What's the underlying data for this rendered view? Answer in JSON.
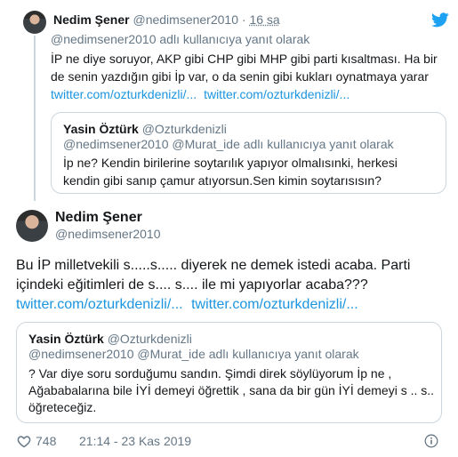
{
  "reply_tweet": {
    "author_name": "Nedim Şener",
    "handle": "@nedimsener2010",
    "dot": "·",
    "time": "16 sa",
    "reply_context": "@nedimsener2010 adlı kullanıcıya yanıt olarak",
    "text_lines": [
      "İP ne diye soruyor, AKP gibi CHP gibi MHP gibi parti kısaltması. Ha bir",
      "de senin yazdığın gibi İp var, o da senin gibi kukları oynatmaya yarar"
    ],
    "links": [
      "twitter.com/ozturkdenizli/...",
      "twitter.com/ozturkdenizli/..."
    ],
    "quote": {
      "author_name": "Yasin Öztürk",
      "handle": "@Ozturkdenizli",
      "reply_context": "@nedimsener2010 @Murat_ide adlı kullanıcıya yanıt olarak",
      "text_lines": [
        "İp ne? Kendin birilerine soytarılık yapıyor olmalısınki, herkesi",
        "kendin gibi sanıp çamur atıyorsun.Sen kimin soytarısısın?"
      ]
    }
  },
  "main_tweet": {
    "author_name": "Nedim Şener",
    "handle": "@nedimsener2010",
    "text_lines": [
      "Bu İP milletvekili s.....s..... diyerek ne demek istedi acaba. Parti",
      "içindeki eğitimleri de s.... s.... ile mi yapıyorlar acaba???"
    ],
    "links": [
      "twitter.com/ozturkdenizli/...",
      "twitter.com/ozturkdenizli/..."
    ],
    "quote": {
      "author_name": "Yasin Öztürk",
      "handle": "@Ozturkdenizli",
      "reply_context": "@nedimsener2010 @Murat_ide adlı kullanıcıya yanıt olarak",
      "text_lines": [
        "? Var diye soru sorduğumu sandın. Şimdi direk söylüyorum İp ne ,",
        "Ağababalarına bile İYİ demeyi öğrettik , sana da bir gün İYİ demeyi s .. s..",
        "öğreteceğiz."
      ]
    },
    "like_count": "748",
    "timestamp": "21:14 - 23 Kas 2019"
  },
  "icons": {
    "bird": "twitter-bird-icon",
    "heart": "heart-icon",
    "info": "info-icon"
  },
  "colors": {
    "link": "#1b95e0",
    "muted": "#657786",
    "border": "#ccd6dd",
    "bird": "#1da1f2"
  }
}
